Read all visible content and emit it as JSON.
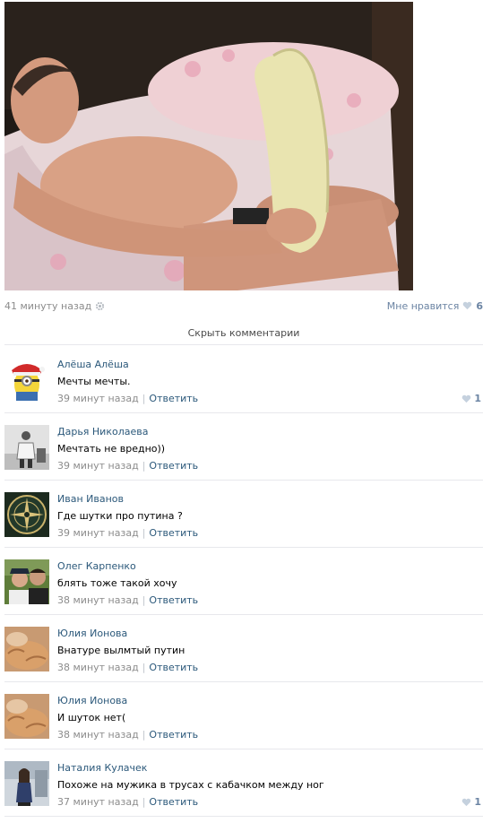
{
  "post": {
    "time": "41 минуту назад",
    "like_label": "Мне нравится",
    "like_count": "6",
    "hide_comments": "Скрыть комментарии"
  },
  "comments": [
    {
      "author": "Алёша Алёша",
      "text": "Мечты мечты.",
      "time": "39 минут назад",
      "reply": "Ответить",
      "likes": "1"
    },
    {
      "author": "Дарья Николаева",
      "text": "Мечтать не вредно))",
      "time": "39 минут назад",
      "reply": "Ответить",
      "likes": ""
    },
    {
      "author": "Иван Иванов",
      "text": "Где шутки про путина ?",
      "time": "39 минут назад",
      "reply": "Ответить",
      "likes": ""
    },
    {
      "author": "Олег Карпенко",
      "text": "блять тоже такой хочу",
      "time": "38 минут назад",
      "reply": "Ответить",
      "likes": ""
    },
    {
      "author": "Юлия Ионова",
      "text": "Внатуре вылмтый путин",
      "time": "38 минут назад",
      "reply": "Ответить",
      "likes": ""
    },
    {
      "author": "Юлия Ионова",
      "text": "И шуток нет(",
      "time": "38 минут назад",
      "reply": "Ответить",
      "likes": ""
    },
    {
      "author": "Наталия Кулачек",
      "text": "Похоже на мужика в трусах с кабачком между ног",
      "time": "37 минут назад",
      "reply": "Ответить",
      "likes": "1"
    }
  ],
  "separator": "|",
  "colors": {
    "link": "#2b587a",
    "meta": "#8c8c8c",
    "like": "#6b84a3"
  }
}
